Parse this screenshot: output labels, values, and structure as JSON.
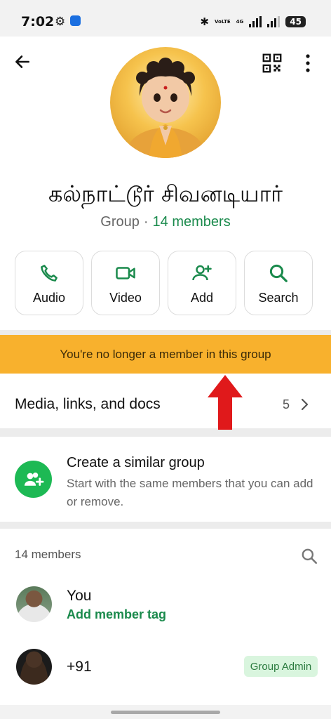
{
  "status_bar": {
    "time": "7:02",
    "volte": "VoLTE",
    "network": "4G",
    "battery": "45"
  },
  "header": {
    "group_name": "கல்நாட்டூர் சிவனடியார்",
    "type_label": "Group",
    "separator": "·",
    "member_count_label": "14 members"
  },
  "actions": [
    {
      "label": "Audio",
      "icon": "phone-icon"
    },
    {
      "label": "Video",
      "icon": "video-icon"
    },
    {
      "label": "Add",
      "icon": "add-person-icon"
    },
    {
      "label": "Search",
      "icon": "search-icon"
    }
  ],
  "banner": {
    "text": "You're no longer a member in this group"
  },
  "media": {
    "label": "Media, links, and docs",
    "count": "5"
  },
  "similar_group": {
    "title": "Create a similar group",
    "description": "Start with the same members that you can add or remove."
  },
  "members": {
    "count_label": "14 members",
    "list": [
      {
        "name": "You",
        "subtitle": "Add member tag",
        "badge": ""
      },
      {
        "name": "+91",
        "subtitle": "",
        "badge": "Group Admin"
      }
    ]
  },
  "colors": {
    "accent_green": "#1a8a4c",
    "banner": "#f8b12d",
    "arrow_red": "#e0191b"
  }
}
